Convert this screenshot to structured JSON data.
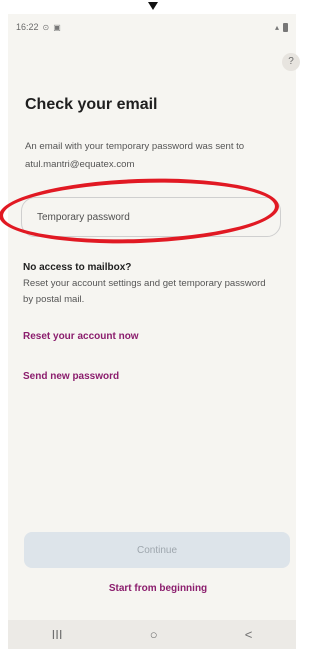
{
  "status": {
    "time": "16:22",
    "left_icons": [
      "alarm-icon",
      "lock-icon"
    ],
    "right_icons": [
      "signal-icon",
      "battery-icon"
    ]
  },
  "help_label": "?",
  "title": "Check your email",
  "description": "An email with your temporary password was sent to atul.mantri@equatex.com",
  "password_field": {
    "placeholder": "Temporary password"
  },
  "no_access": {
    "title": "No access to mailbox?",
    "text": "Reset your account settings and get temporary password by postal mail."
  },
  "links": {
    "reset": "Reset your account now",
    "send": "Send new password"
  },
  "buttons": {
    "continue": "Continue",
    "start": "Start from beginning"
  },
  "nav": {
    "recent": "III",
    "home": "○",
    "back": "<"
  },
  "colors": {
    "accent": "#8b1d6d",
    "annotation": "#e11923",
    "disabled_button": "#dde4ea"
  }
}
